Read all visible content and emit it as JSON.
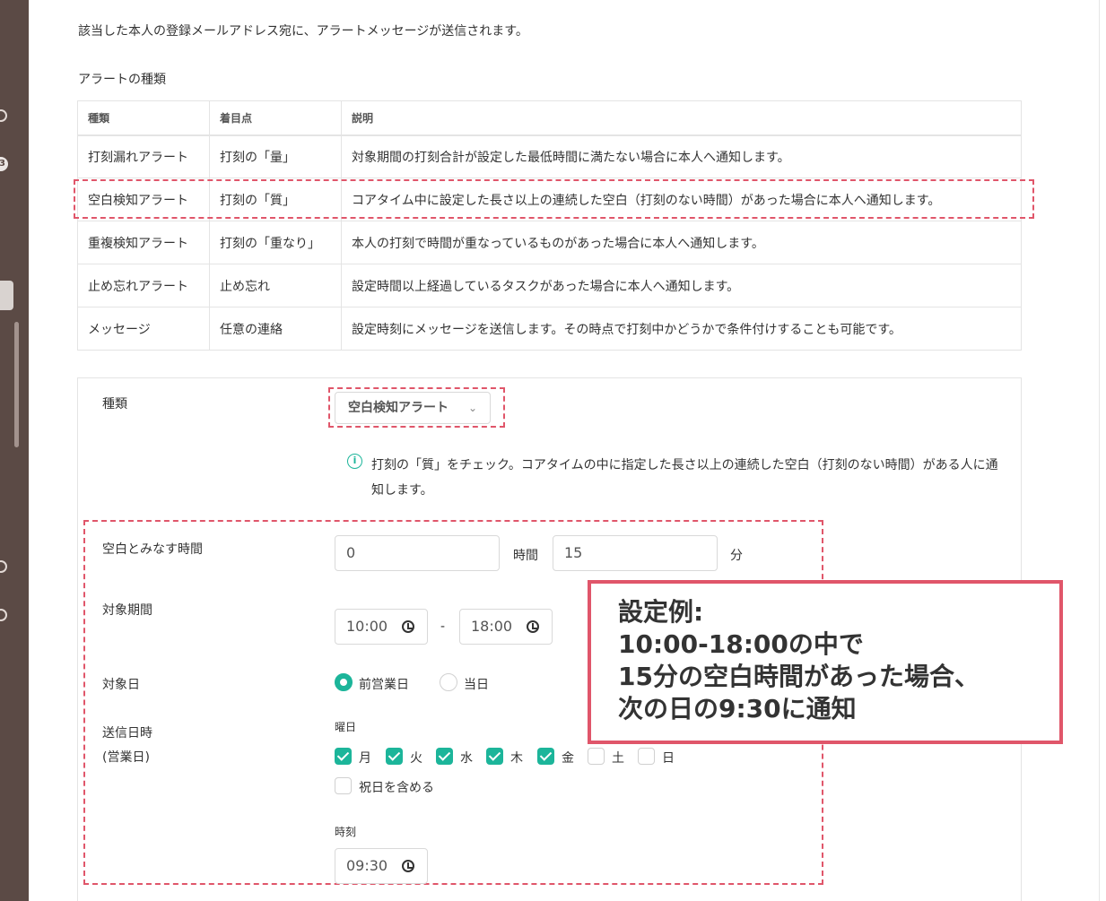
{
  "intro_text": "該当した本人の登録メールアドレス宛に、アラートメッセージが送信されます。",
  "section_title": "アラートの種類",
  "table": {
    "headers": [
      "種類",
      "着目点",
      "説明"
    ],
    "rows": [
      [
        "打刻漏れアラート",
        "打刻の「量」",
        "対象期間の打刻合計が設定した最低時間に満たない場合に本人へ通知します。"
      ],
      [
        "空白検知アラート",
        "打刻の「質」",
        "コアタイム中に設定した長さ以上の連続した空白（打刻のない時間）があった場合に本人へ通知します。"
      ],
      [
        "重複検知アラート",
        "打刻の「重なり」",
        "本人の打刻で時間が重なっているものがあった場合に本人へ通知します。"
      ],
      [
        "止め忘れアラート",
        "止め忘れ",
        "設定時間以上経過しているタスクがあった場合に本人へ通知します。"
      ],
      [
        "メッセージ",
        "任意の連絡",
        "設定時刻にメッセージを送信します。その時点で打刻中かどうかで条件付けすることも可能です。"
      ]
    ]
  },
  "form": {
    "type_label": "種類",
    "type_value": "空白検知アラート",
    "info_text": "打刻の「質」をチェック。コアタイムの中に指定した長さ以上の連続した空白（打刻のない時間）がある人に通知します。",
    "blank_time_label": "空白とみなす時間",
    "hours_value": "0",
    "hours_unit": "時間",
    "minutes_value": "15",
    "minutes_unit": "分",
    "period_label": "対象期間",
    "period_start": "10:00",
    "period_sep": "-",
    "period_end": "18:00",
    "target_day_label": "対象日",
    "target_day_options": [
      {
        "label": "前営業日",
        "selected": true
      },
      {
        "label": "当日",
        "selected": false
      }
    ],
    "send_label_line1": "送信日時",
    "send_label_line2": "(営業日)",
    "weekday_label": "曜日",
    "weekdays": [
      {
        "label": "月",
        "checked": true
      },
      {
        "label": "火",
        "checked": true
      },
      {
        "label": "水",
        "checked": true
      },
      {
        "label": "木",
        "checked": true
      },
      {
        "label": "金",
        "checked": true
      },
      {
        "label": "土",
        "checked": false
      },
      {
        "label": "日",
        "checked": false
      }
    ],
    "holiday_label": "祝日を含める",
    "holiday_checked": false,
    "time_label": "時刻",
    "time_value": "09:30"
  },
  "callout": {
    "lines": [
      "設定例:",
      "10:00-18:00の中で",
      "15分の空白時間があった場合、",
      "次の日の9:30に通知"
    ]
  },
  "colors": {
    "accent": "#1cb59a",
    "highlight": "#e0566a",
    "sidebar": "#5b4a45"
  }
}
